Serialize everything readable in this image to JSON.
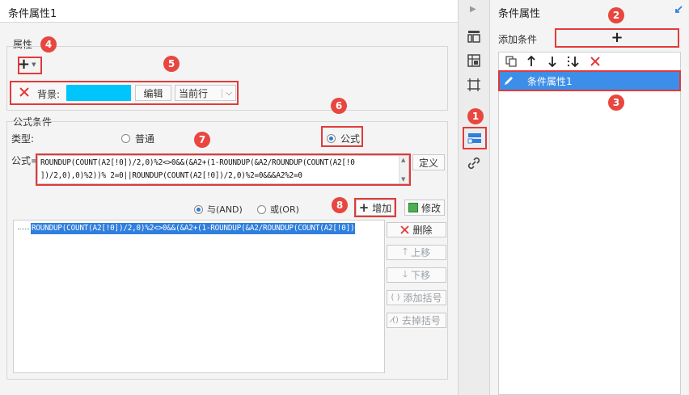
{
  "left_panel": {
    "title": "条件属性1",
    "attr_group_label": "属性",
    "bg_label": "背景:",
    "bg_color": "#00c4fc",
    "edit_button": "编辑",
    "scope_select": "当前行",
    "formula_group_label": "公式条件",
    "type_label": "类型:",
    "radio_normal": "普通",
    "radio_formula": "公式",
    "formula_label": "公式=",
    "formula_line1": "ROUNDUP(COUNT(A2[!0])/2,0)%2<>0&&(&A2+(1-ROUNDUP(&A2/ROUNDUP(COUNT(A2[!0",
    "formula_line2": "])/2,0),0)%2))% 2=0||ROUNDUP(COUNT(A2[!0])/2,0)%2=0&&&A2%2=0",
    "define_button": "定义",
    "radio_and": "与(AND)",
    "radio_or": "或(OR)",
    "add_button": "增加",
    "modify_button": "修改",
    "condition_item": "ROUNDUP(COUNT(A2[!0])/2,0)%2<>0&&(&A2+(1-ROUNDUP(&A2/ROUNDUP(COUNT(A2[!0])",
    "delete_button": "删除",
    "move_up_button": "上移",
    "move_down_button": "下移",
    "add_bracket_button": "添加括号",
    "remove_bracket_button": "去掉括号"
  },
  "right_panel": {
    "title": "条件属性",
    "add_condition_label": "添加条件",
    "add_symbol": "+",
    "list_item": "条件属性1"
  },
  "badges": [
    "1",
    "2",
    "3",
    "4",
    "5",
    "6",
    "7",
    "8"
  ],
  "colors": {
    "accent_blue": "#3d8ee8",
    "highlight_red": "#e23a3a",
    "badge_red": "#e8463f"
  }
}
